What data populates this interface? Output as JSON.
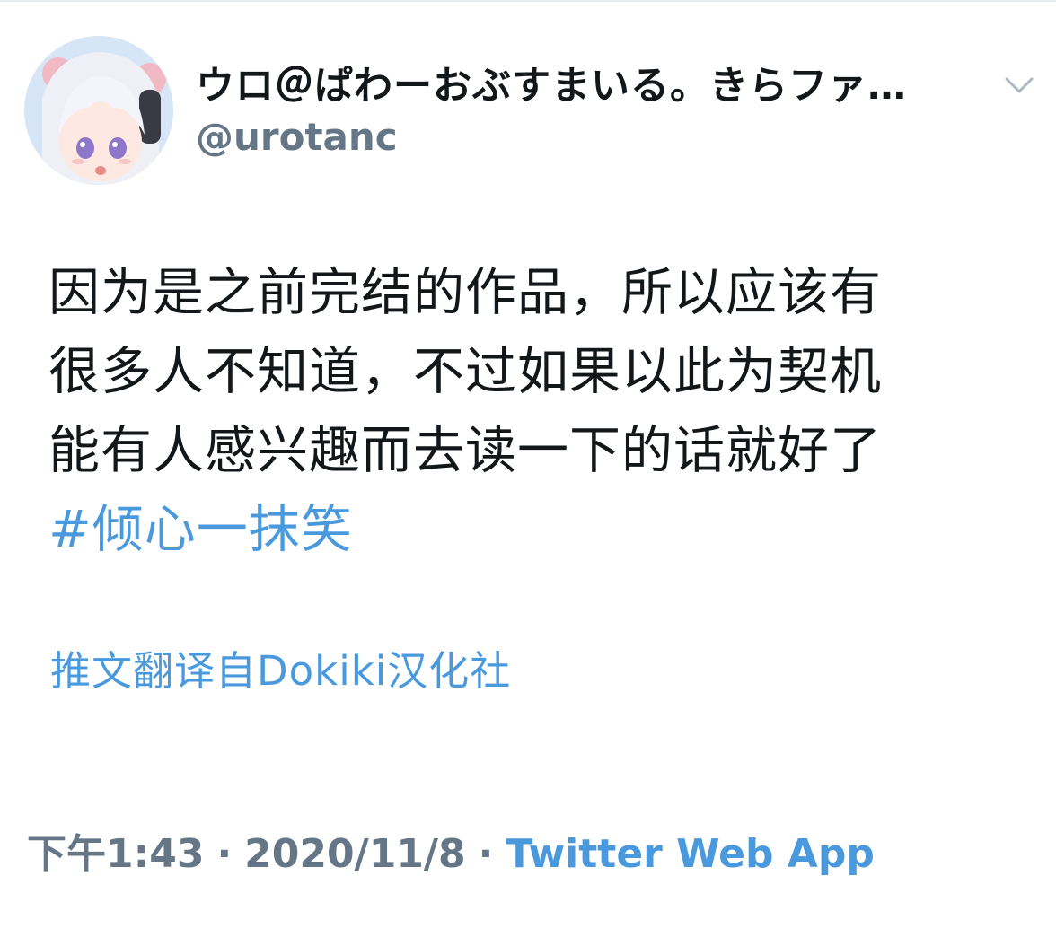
{
  "tweet": {
    "author": {
      "display_name": "ウロ＠ぱわーおぶすまいる。きらファ…",
      "handle": "@urotanc"
    },
    "text_lines": [
      "因为是之前完结的作品，所以应该有",
      "很多人不知道，不过如果以此为契机",
      "能有人感兴趣而去读一下的话就好了"
    ],
    "hashtag": "#倾心一抹笑",
    "translation_note": "推文翻译自Dokiki汉化社",
    "time": "下午1:43",
    "separator": "·",
    "date": "2020/11/8",
    "source": "Twitter Web App"
  },
  "icons": {
    "caret": "chevron-down-icon"
  },
  "colors": {
    "text": "#14171a",
    "secondary": "#657786",
    "link": "#4a99dc"
  }
}
